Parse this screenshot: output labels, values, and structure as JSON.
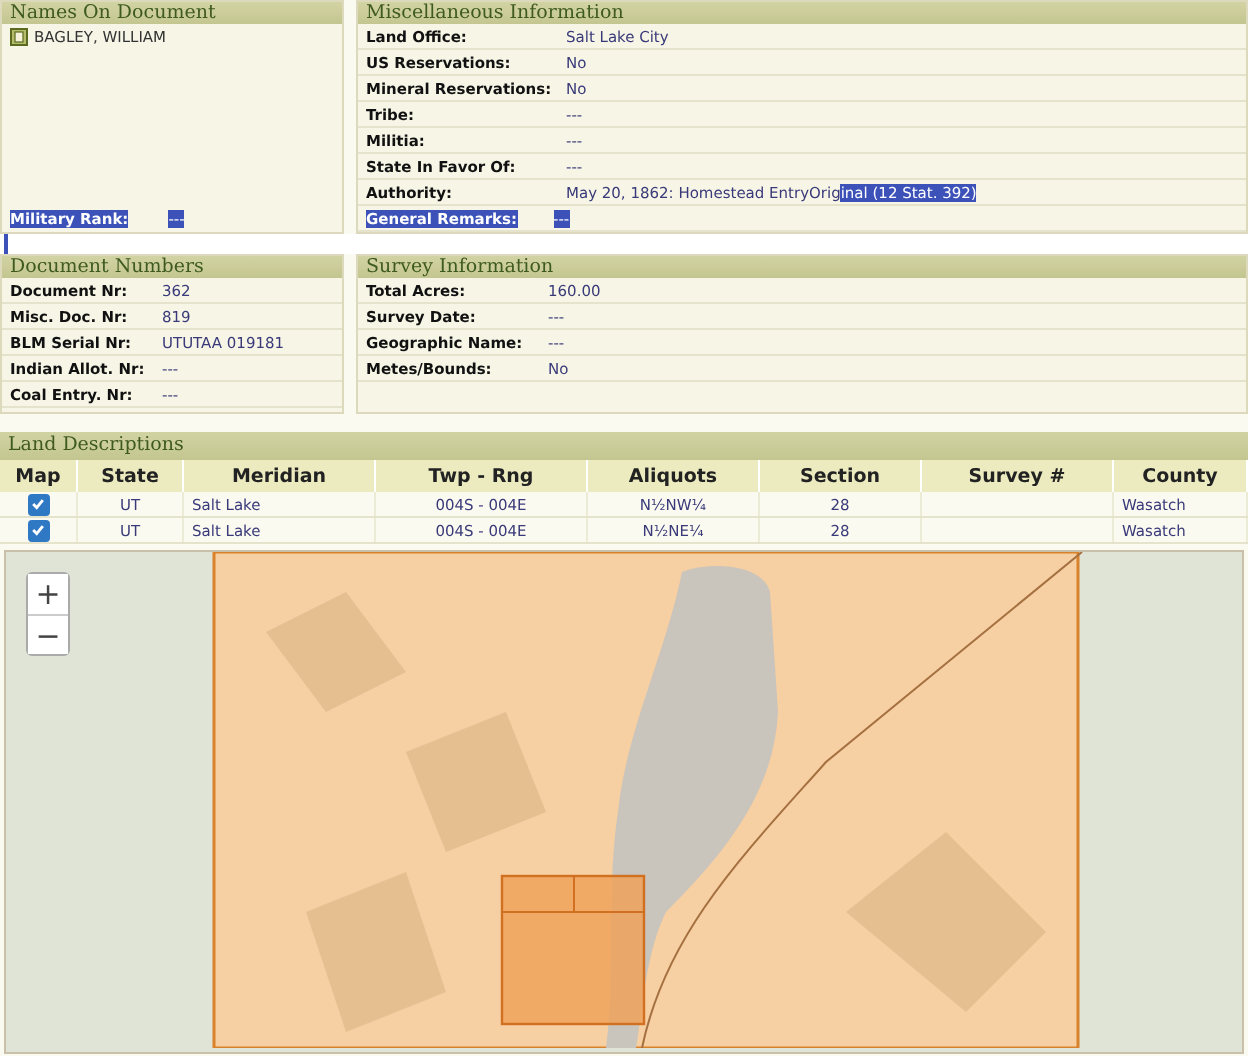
{
  "names_panel": {
    "title": "Names On Document",
    "names": [
      "BAGLEY, WILLIAM"
    ],
    "military_rank": {
      "label": "Military Rank:",
      "value": "---",
      "selected": true
    }
  },
  "misc_panel": {
    "title": "Miscellaneous Information",
    "rows": [
      {
        "label": "Land Office:",
        "value": "Salt Lake City",
        "selected": false
      },
      {
        "label": "US Reservations:",
        "value": "No",
        "selected": false
      },
      {
        "label": "Mineral Reservations:",
        "value": "No",
        "selected": false
      },
      {
        "label": "Tribe:",
        "value": "---",
        "selected": false
      },
      {
        "label": "Militia:",
        "value": "---",
        "selected": false
      },
      {
        "label": "State In Favor Of:",
        "value": "---",
        "selected": false
      },
      {
        "label": "Authority:",
        "value": "May 20, 1862: Homestead EntryOrig",
        "selected_value": "inal (12 Stat. 392)",
        "selected": false
      },
      {
        "label": "General Remarks:",
        "value": "---",
        "selected": true
      }
    ]
  },
  "document_numbers": {
    "title": "Document Numbers",
    "rows": [
      {
        "label": "Document Nr:",
        "value": "362"
      },
      {
        "label": "Misc. Doc. Nr:",
        "value": "819"
      },
      {
        "label": "BLM Serial Nr:",
        "value": "UTUTAA 019181"
      },
      {
        "label": "Indian Allot. Nr:",
        "value": "---"
      },
      {
        "label": "Coal Entry. Nr:",
        "value": "---"
      }
    ]
  },
  "survey_information": {
    "title": "Survey Information",
    "rows": [
      {
        "label": "Total Acres:",
        "value": "160.00"
      },
      {
        "label": "Survey Date:",
        "value": "---"
      },
      {
        "label": "Geographic Name:",
        "value": "---"
      },
      {
        "label": "Metes/Bounds:",
        "value": "No"
      }
    ]
  },
  "land_descriptions": {
    "title": "Land Descriptions",
    "columns": [
      "Map",
      "State",
      "Meridian",
      "Twp - Rng",
      "Aliquots",
      "Section",
      "Survey #",
      "County"
    ],
    "rows": [
      {
        "checked": true,
        "state": "UT",
        "meridian": "Salt Lake",
        "twp_rng": "004S - 004E",
        "aliquots": "N½NW¼",
        "section": "28",
        "county": "Wasatch"
      },
      {
        "checked": true,
        "state": "UT",
        "meridian": "Salt Lake",
        "twp_rng": "004S - 004E",
        "aliquots": "N½NE¼",
        "section": "28",
        "county": "Wasatch"
      }
    ]
  },
  "map": {
    "zoom_in": "+",
    "zoom_out": "−"
  }
}
